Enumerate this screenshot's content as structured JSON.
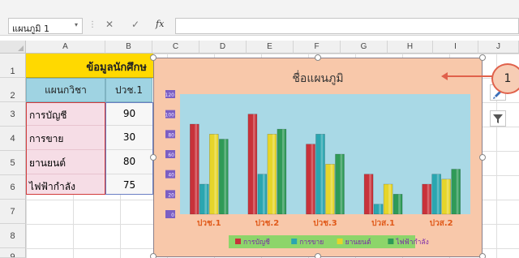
{
  "formula_bar": {
    "name_box": "แผนภูมิ 1",
    "name_box_arrow": "▾",
    "separator": "⋮",
    "cancel": "✕",
    "enter": "✓",
    "fx": "fx",
    "formula": ""
  },
  "columns": [
    "A",
    "B",
    "C",
    "D",
    "E",
    "F",
    "G",
    "H",
    "I",
    "J"
  ],
  "rows": [
    "1",
    "2",
    "3",
    "4",
    "5",
    "6",
    "7",
    "8",
    "9"
  ],
  "sheet": {
    "title_cell": "ข้อมูลนักศึกษ",
    "header_dept": "แผนกวิชา",
    "header_col": "ปวช.1",
    "departments": [
      {
        "name": "การบัญชี",
        "value": "90"
      },
      {
        "name": "การขาย",
        "value": "30"
      },
      {
        "name": "ยานยนต์",
        "value": "80"
      },
      {
        "name": "ไฟฟ้ากำลัง",
        "value": "75"
      }
    ]
  },
  "chart_data": {
    "type": "bar",
    "title": "ชื่อแผนภูมิ",
    "categories": [
      "ปวช.1",
      "ปวช.2",
      "ปวช.3",
      "ปวส.1",
      "ปวส.2"
    ],
    "series": [
      {
        "name": "การบัญชี",
        "values": [
          90,
          100,
          70,
          40,
          30
        ],
        "color": "#c8323a"
      },
      {
        "name": "การขาย",
        "values": [
          30,
          40,
          80,
          10,
          40
        ],
        "color": "#2aa6b0"
      },
      {
        "name": "ยานยนต์",
        "values": [
          80,
          80,
          50,
          30,
          35
        ],
        "color": "#e6d52a"
      },
      {
        "name": "ไฟฟ้ากำลัง",
        "values": [
          75,
          85,
          60,
          20,
          45
        ],
        "color": "#2f9a57"
      }
    ],
    "yticks": [
      "120",
      "100",
      "80",
      "60",
      "40",
      "20",
      "0"
    ],
    "ylim": [
      0,
      120
    ],
    "legend_position": "bottom",
    "colors": {
      "plot_bg": "#a9d9e6",
      "chart_bg": "#f8c8aa",
      "axis_label_bg": "#7b5fc4",
      "tick_label_color": "#e05a1a"
    }
  },
  "callout": {
    "label": "1"
  },
  "colors": {
    "title_bg": "#ffd900",
    "header_bg": "#9fd3e2",
    "body_bg": "#f6dde6",
    "value_bg": "#f7f7f7",
    "border_red": "#d23c3c",
    "arrow_red": "#e0614b"
  }
}
